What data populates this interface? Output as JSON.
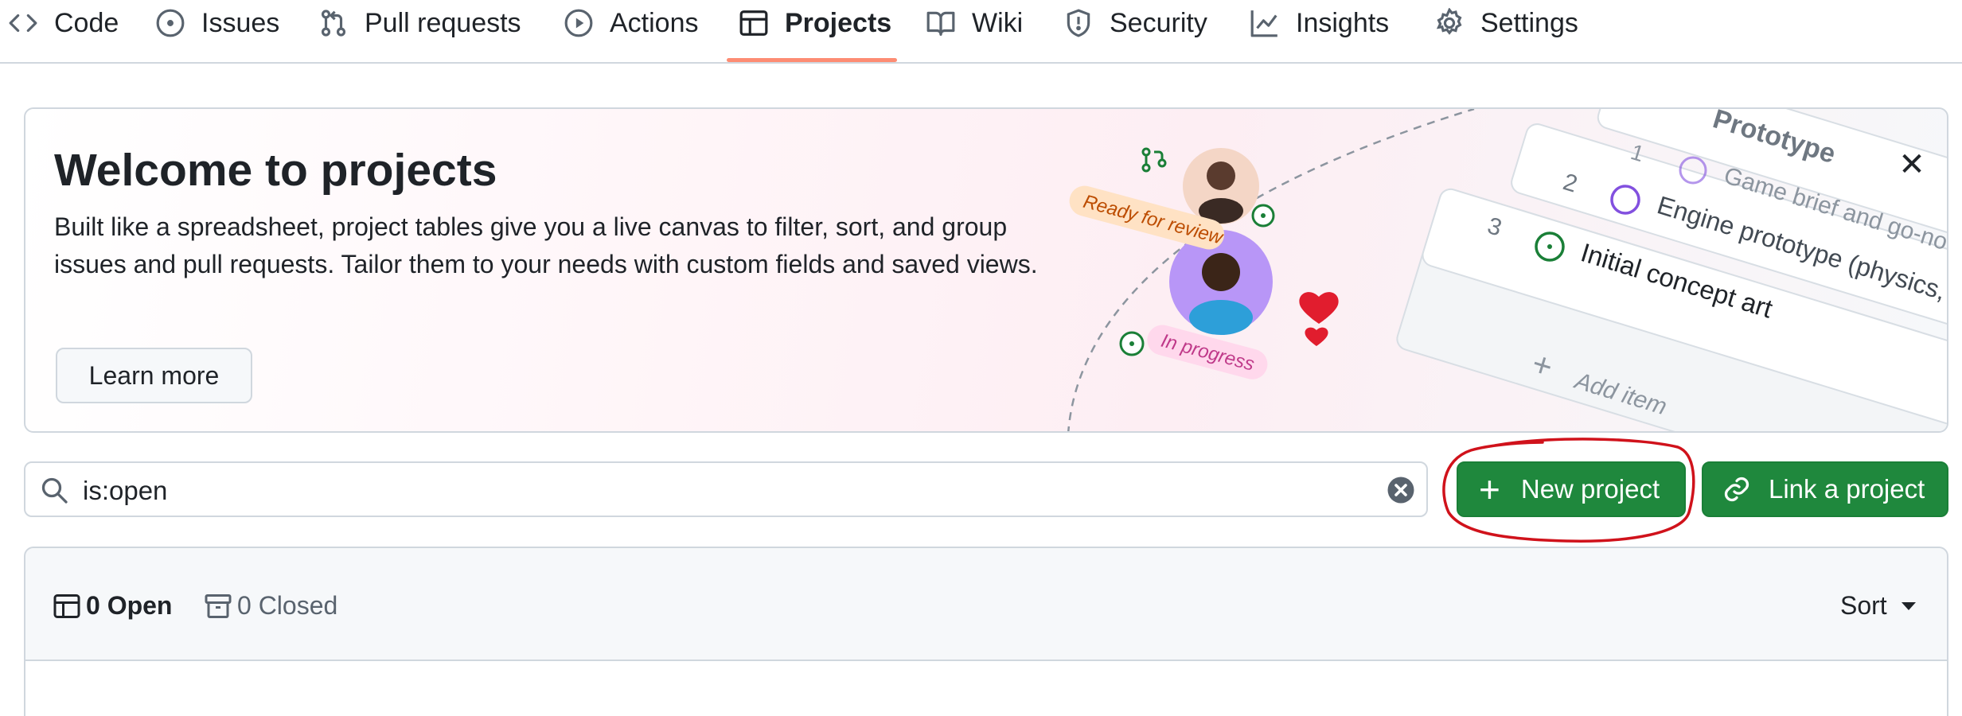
{
  "nav": {
    "items": [
      {
        "label": "Code",
        "icon": "code-icon"
      },
      {
        "label": "Issues",
        "icon": "issue-opened-icon"
      },
      {
        "label": "Pull requests",
        "icon": "git-pull-request-icon"
      },
      {
        "label": "Actions",
        "icon": "play-icon"
      },
      {
        "label": "Projects",
        "icon": "table-icon",
        "active": true
      },
      {
        "label": "Wiki",
        "icon": "book-icon"
      },
      {
        "label": "Security",
        "icon": "shield-icon"
      },
      {
        "label": "Insights",
        "icon": "graph-icon"
      },
      {
        "label": "Settings",
        "icon": "gear-icon"
      }
    ],
    "active_underline_color": "#fd8c73"
  },
  "banner": {
    "title": "Welcome to projects",
    "description": "Built like a spreadsheet, project tables give you a live canvas to filter, sort, and group issues and pull requests. Tailor them to your needs with custom fields and saved views.",
    "learn_more_label": "Learn more",
    "close_label": "✕",
    "illustration": {
      "ready_label": "Ready for review",
      "in_progress_label": "In progress",
      "group_label": "Prototype",
      "rows": [
        {
          "num": "1",
          "text": "Game brief and go-no-"
        },
        {
          "num": "2",
          "text": "Engine prototype (physics, renderin"
        },
        {
          "num": "3",
          "text": "Initial concept art"
        }
      ],
      "add_item_label": "Add item",
      "add_symbol": "+"
    }
  },
  "search": {
    "value": "is:open"
  },
  "buttons": {
    "new_project_label": "New project",
    "new_project_plus": "+",
    "link_project_label": "Link a project"
  },
  "list": {
    "open_label": "0 Open",
    "closed_label": "0 Closed",
    "sort_label": "Sort"
  },
  "colors": {
    "primary_button": "#1f883d",
    "annotation_circle": "#d0121b",
    "border": "#d0d7de"
  }
}
